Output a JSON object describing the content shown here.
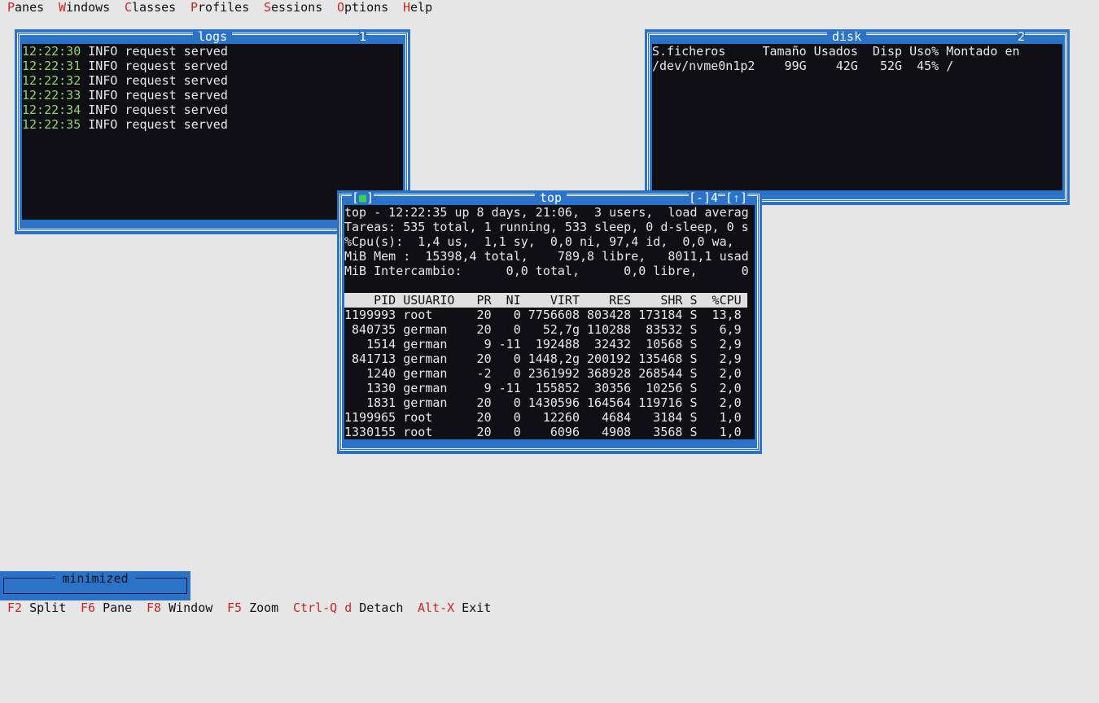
{
  "menu": [
    {
      "hot": "P",
      "rest": "anes"
    },
    {
      "hot": "W",
      "rest": "indows"
    },
    {
      "hot": "C",
      "rest": "lasses"
    },
    {
      "hot": "P",
      "rest": "rofiles",
      "pre": ""
    },
    {
      "hot": "S",
      "rest": "essions"
    },
    {
      "hot": "O",
      "rest": "ptions"
    },
    {
      "hot": "H",
      "rest": "elp"
    }
  ],
  "logs": {
    "title": "logs",
    "num": "1",
    "lines": [
      {
        "time": "12:22:30",
        "msg": " INFO request served"
      },
      {
        "time": "12:22:31",
        "msg": " INFO request served"
      },
      {
        "time": "12:22:32",
        "msg": " INFO request served"
      },
      {
        "time": "12:22:33",
        "msg": " INFO request served"
      },
      {
        "time": "12:22:34",
        "msg": " INFO request served"
      },
      {
        "time": "12:22:35",
        "msg": " INFO request served"
      }
    ]
  },
  "disk": {
    "title": "disk",
    "num": "2",
    "lines": [
      "S.ficheros     Tamaño Usados  Disp Uso% Montado en",
      "/dev/nvme0n1p2    99G    42G   52G  45% /"
    ]
  },
  "top": {
    "title": "top",
    "num": "4",
    "close_btn": "[■]",
    "min_btn": "[-]",
    "max_btn": "[↑]",
    "summary": [
      "top - 12:22:35 up 8 days, 21:06,  3 users,  load averag",
      "Tareas: 535 total, 1 running, 533 sleep, 0 d-sleep, 0 s",
      "%Cpu(s):  1,4 us,  1,1 sy,  0,0 ni, 97,4 id,  0,0 wa,",
      "MiB Mem :  15398,4 total,    789,8 libre,   8011,1 usad",
      "MiB Intercambio:      0,0 total,      0,0 libre,      0",
      ""
    ],
    "header": "    PID USUARIO   PR  NI    VIRT    RES    SHR S  %CPU",
    "rows": [
      "1199993 root      20   0 7756608 803428 173184 S  13,8",
      " 840735 german    20   0   52,7g 110288  83532 S   6,9",
      "   1514 german     9 -11  192488  32432  10568 S   2,9",
      " 841713 german    20   0 1448,2g 200192 135468 S   2,9",
      "   1240 german    -2   0 2361992 368928 268544 S   2,0",
      "   1330 german     9 -11  155852  30356  10256 S   2,0",
      "   1831 german    20   0 1430596 164564 119716 S   2,0",
      "1199965 root      20   0   12260   4684   3184 S   1,0",
      "1330155 root      20   0    6096   4908   3568 S   1,0"
    ]
  },
  "minimized": {
    "title": "minimized"
  },
  "status": [
    {
      "key": "F2",
      "label": " Split"
    },
    {
      "key": "F6",
      "label": " Pane"
    },
    {
      "key": "F8",
      "label": " Window"
    },
    {
      "key": "F5",
      "label": " Zoom"
    },
    {
      "key": "Ctrl-Q d",
      "label": " Detach"
    },
    {
      "key": "Alt-X",
      "label": " Exit"
    }
  ],
  "colors": {
    "window": "#2b73c9",
    "content": "#101014",
    "desktop": "#e6e6e6",
    "hotkey": "#c8261f",
    "timestamp": "#8fd46d"
  }
}
